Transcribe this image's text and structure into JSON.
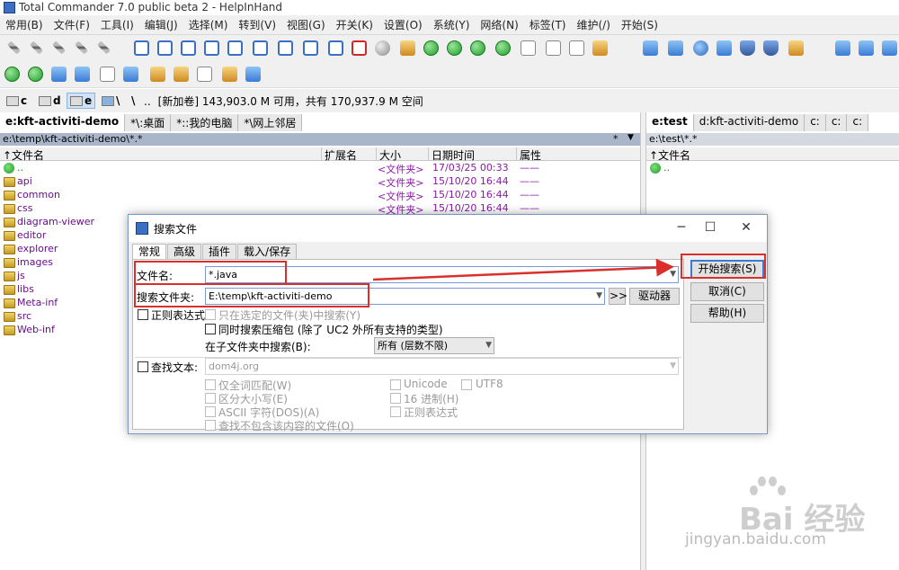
{
  "window": {
    "title": "Total Commander 7.0 public beta 2 - HelpInHand"
  },
  "menubar": {
    "items": [
      "常用(B)",
      "文件(F)",
      "工具(I)",
      "编辑(J)",
      "选择(M)",
      "转到(V)",
      "视图(G)",
      "开关(K)",
      "设置(O)",
      "系统(Y)",
      "网络(N)",
      "标签(T)",
      "维护(/)",
      "开始(S)"
    ]
  },
  "drives": {
    "c": "c",
    "d": "d",
    "e": "e",
    "net": "\\",
    "root": "\\",
    "parent": "..",
    "volume_info": "[新加卷]  143,903.0 M 可用，共有 170,937.9 M 空间"
  },
  "left_panel": {
    "tabs": [
      "e:kft-activiti-demo",
      "*\\:桌面",
      "*::我的电脑",
      "*\\网上邻居"
    ],
    "path": "e:\\temp\\kft-activiti-demo\\*.*",
    "path_filter": "*",
    "path_dropdown": "▼",
    "headers": {
      "name": "↑文件名",
      "ext": "扩展名",
      "size": "大小",
      "date": "日期时间",
      "attr": "属性"
    },
    "files": [
      {
        "name": "..",
        "size": "<文件夹>",
        "date": "17/03/25 00:33",
        "attr": "——"
      },
      {
        "name": "api",
        "size": "<文件夹>",
        "date": "15/10/20 16:44",
        "attr": "——"
      },
      {
        "name": "common",
        "size": "<文件夹>",
        "date": "15/10/20 16:44",
        "attr": "——"
      },
      {
        "name": "css",
        "size": "<文件夹>",
        "date": "15/10/20 16:44",
        "attr": "——"
      },
      {
        "name": "diagram-viewer",
        "size": "",
        "date": "",
        "attr": ""
      },
      {
        "name": "editor",
        "size": "",
        "date": "",
        "attr": ""
      },
      {
        "name": "explorer",
        "size": "",
        "date": "",
        "attr": ""
      },
      {
        "name": "images",
        "size": "",
        "date": "",
        "attr": ""
      },
      {
        "name": "js",
        "size": "",
        "date": "",
        "attr": ""
      },
      {
        "name": "libs",
        "size": "",
        "date": "",
        "attr": ""
      },
      {
        "name": "Meta-inf",
        "size": "",
        "date": "",
        "attr": ""
      },
      {
        "name": "src",
        "size": "",
        "date": "",
        "attr": ""
      },
      {
        "name": "Web-inf",
        "size": "",
        "date": "",
        "attr": ""
      }
    ]
  },
  "right_panel": {
    "tabs": [
      "e:test",
      "d:kft-activiti-demo",
      "c:",
      "c:",
      "c:"
    ],
    "path": "e:\\test\\*.*",
    "header_name": "↑文件名",
    "parent": ".."
  },
  "dialog": {
    "title": "搜索文件",
    "tabs": [
      "常规",
      "高级",
      "插件",
      "载入/保存"
    ],
    "filename_label": "文件名:",
    "filename_value": "*.java",
    "folder_label": "搜索文件夹:",
    "folder_value": "E:\\temp\\kft-activiti-demo",
    "browse_button": ">>",
    "drives_button": "驱动器",
    "regex_label": "正则表达式",
    "only_selected_label": "只在选定的文件(夹)中搜索(Y)",
    "archives_label": "同时搜索压缩包 (除了 UC2 外所有支持的类型)",
    "subdir_label": "在子文件夹中搜索(B):",
    "subdir_value": "所有 (层数不限)",
    "find_text_label": "查找文本:",
    "find_text_value": "dom4j.org",
    "whole_word_label": "仅全词匹配(W)",
    "case_label": "区分大小写(E)",
    "ascii_label": "ASCII 字符(DOS)(A)",
    "not_containing_label": "查找不包含该内容的文件(O)",
    "unicode_label": "Unicode",
    "utf8_label": "UTF8",
    "hex_label": "16 进制(H)",
    "regex2_label": "正则表达式",
    "start_button": "开始搜索(S)",
    "cancel_button": "取消(C)",
    "help_button": "帮助(H)"
  },
  "watermark": {
    "main": "Bai 经验",
    "sub": "jingyan.baidu.com"
  },
  "colors": {
    "annotation_red": "#d9302b",
    "folder_text": "#6a0f8e"
  }
}
